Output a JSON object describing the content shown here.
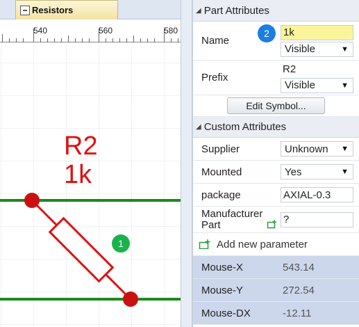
{
  "tab": {
    "title": "Resistors"
  },
  "ruler": {
    "ticks": [
      "540",
      "560",
      "580"
    ]
  },
  "schematic": {
    "ref": "R2",
    "value": "1k",
    "wire_color": "#1d8a1d",
    "part_color": "#e01010"
  },
  "badges": {
    "one": "1",
    "two": "2"
  },
  "part_attributes": {
    "header": "Part Attributes",
    "name_label": "Name",
    "name_value": "1k",
    "name_visibility": "Visible",
    "prefix_label": "Prefix",
    "prefix_value": "R2",
    "prefix_visibility": "Visible",
    "edit_button": "Edit Symbol..."
  },
  "custom_attributes": {
    "header": "Custom Attributes",
    "supplier_label": "Supplier",
    "supplier_value": "Unknown",
    "mounted_label": "Mounted",
    "mounted_value": "Yes",
    "package_label": "package",
    "package_value": "AXIAL-0.3",
    "mpart_label_1": "Manufacturer",
    "mpart_label_2": "Part",
    "mpart_value": "?",
    "add_param": "Add new parameter"
  },
  "readouts": [
    {
      "label": "Mouse-X",
      "value": "543.14"
    },
    {
      "label": "Mouse-Y",
      "value": "272.54"
    },
    {
      "label": "Mouse-DX",
      "value": "-12.11"
    }
  ],
  "colors": {
    "badge1": "#19b34a",
    "badge2": "#1a7fe0",
    "accent": "#fbf59a"
  }
}
